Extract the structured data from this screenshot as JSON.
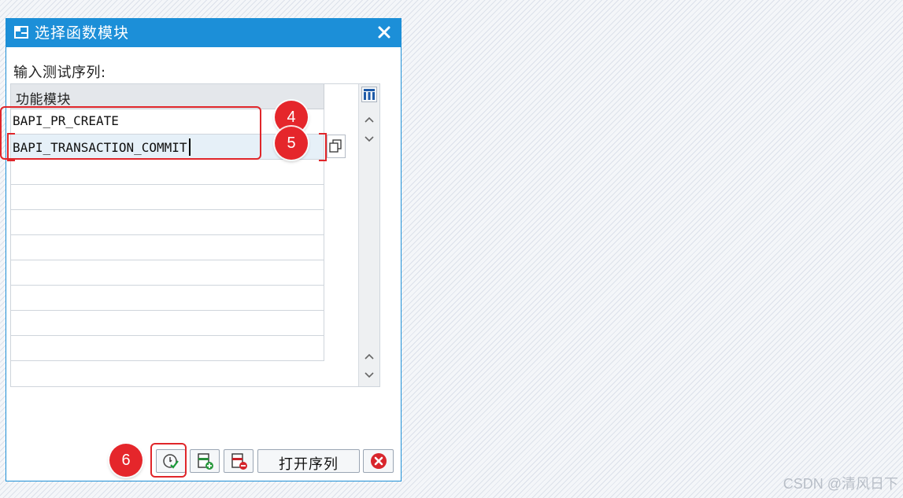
{
  "dialog": {
    "title": "选择函数模块",
    "prompt": "输入测试序列:",
    "table": {
      "column_header": "功能模块",
      "rows": [
        "BAPI_PR_CREATE",
        "BAPI_TRANSACTION_COMMIT",
        "",
        "",
        "",
        "",
        "",
        "",
        "",
        ""
      ],
      "selected_row": 1
    },
    "footer": {
      "open_sequence_label": "打开序列"
    }
  },
  "annotations": {
    "badge_4": "4",
    "badge_5": "5",
    "badge_6": "6"
  },
  "watermark": "CSDN @清风日下",
  "colors": {
    "titlebar": "#1c8fd8",
    "annotation_red": "#e0262a",
    "selected_row": "#e6f0f8"
  },
  "icons": {
    "title": "dialog-icon",
    "close": "close-icon",
    "column_settings": "table-settings-icon",
    "scroll_up": "chevron-up-icon",
    "scroll_down": "chevron-down-icon",
    "copy": "copy-icon",
    "execute": "execute-check-icon",
    "insert_row": "insert-row-icon",
    "delete_row": "delete-row-icon",
    "cancel": "cancel-icon"
  }
}
